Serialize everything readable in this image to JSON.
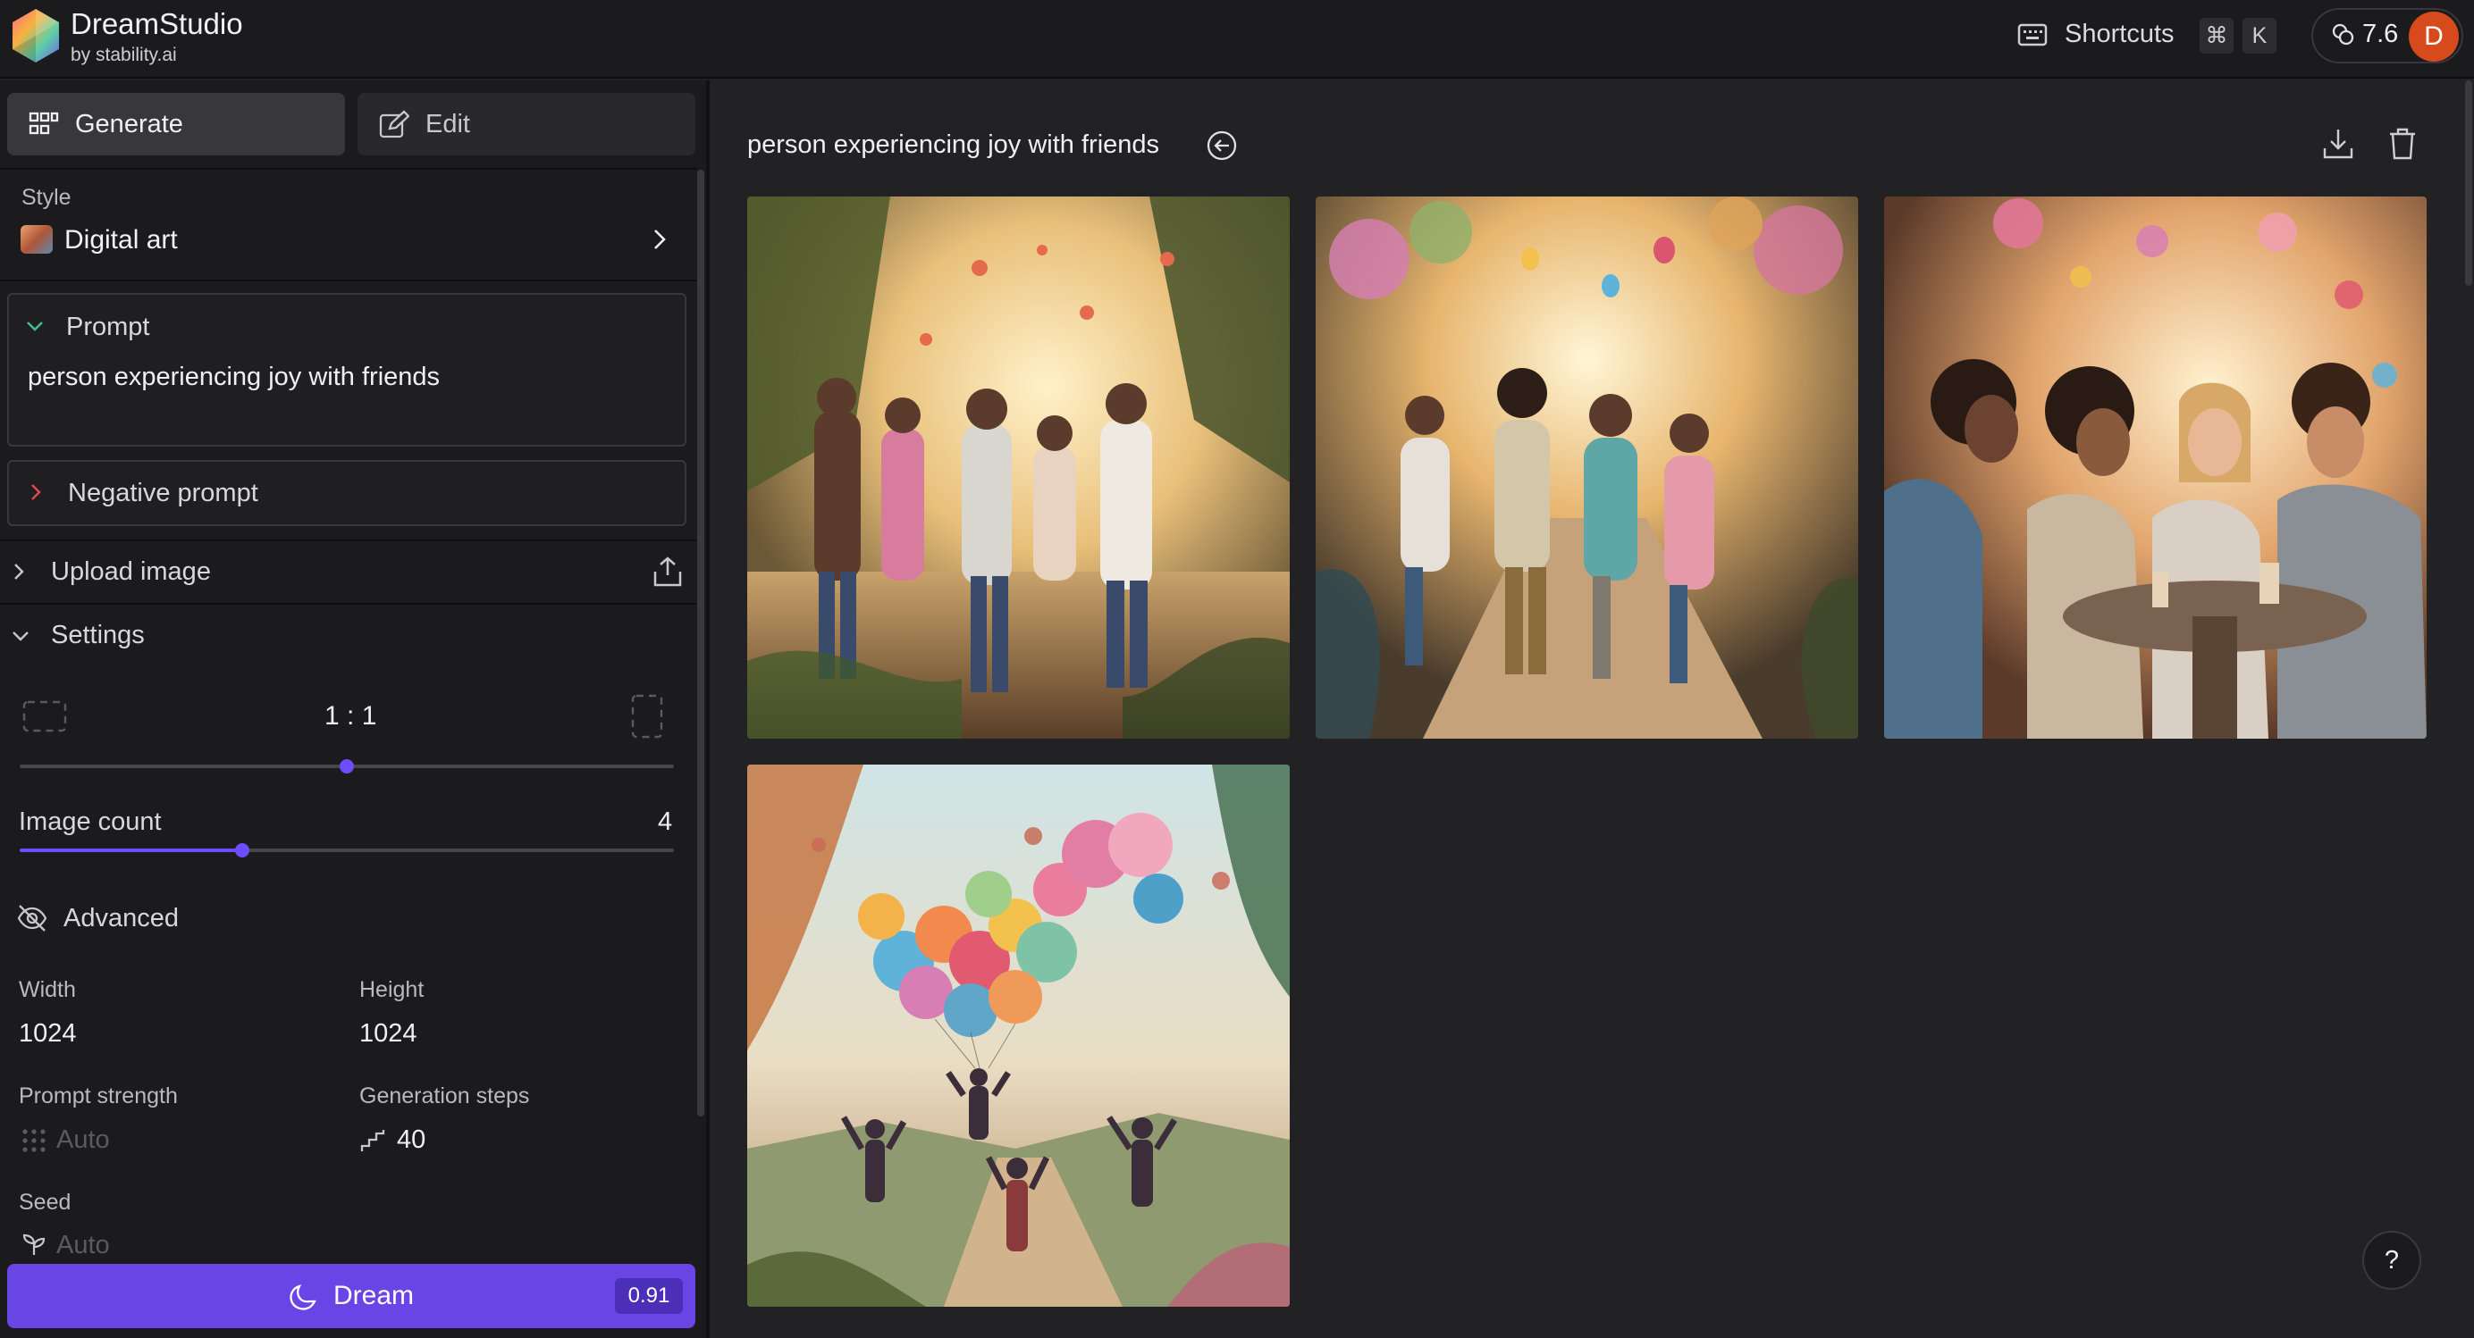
{
  "app": {
    "name": "DreamStudio",
    "byline": "by stability.ai"
  },
  "header": {
    "shortcuts_label": "Shortcuts",
    "shortcut_keys": [
      "⌘",
      "K"
    ],
    "credits": "7.6",
    "avatar_initial": "D"
  },
  "tabs": [
    {
      "label": "Generate",
      "icon": "grid-icon",
      "active": true
    },
    {
      "label": "Edit",
      "icon": "edit-icon",
      "active": false
    }
  ],
  "style": {
    "label": "Style",
    "value": "Digital art"
  },
  "prompt": {
    "title": "Prompt",
    "text": "person experiencing joy with friends",
    "expanded": true
  },
  "negative_prompt": {
    "title": "Negative prompt",
    "expanded": false
  },
  "upload": {
    "label": "Upload image"
  },
  "settings": {
    "label": "Settings",
    "aspect_ratio": "1 : 1",
    "aspect_ratio_position": 0.5,
    "image_count_label": "Image count",
    "image_count": "4",
    "image_count_position": 0.34
  },
  "advanced": {
    "label": "Advanced",
    "width_label": "Width",
    "width": "1024",
    "height_label": "Height",
    "height": "1024",
    "prompt_strength_label": "Prompt strength",
    "prompt_strength": "Auto",
    "steps_label": "Generation steps",
    "steps": "40",
    "seed_label": "Seed",
    "seed": "Auto"
  },
  "dream": {
    "label": "Dream",
    "cost": "0.91"
  },
  "results": {
    "title": "person experiencing joy with friends",
    "images": [
      {
        "name": "result-image-friends-walking-forest"
      },
      {
        "name": "result-image-friends-running-path"
      },
      {
        "name": "result-image-friends-laughing-table"
      },
      {
        "name": "result-image-balloons-jumping"
      }
    ]
  },
  "help": {
    "label": "?"
  },
  "colors": {
    "accent": "#6a45e6",
    "avatar": "#d64a1c",
    "panel": "#1b1b1e",
    "main": "#222225"
  }
}
